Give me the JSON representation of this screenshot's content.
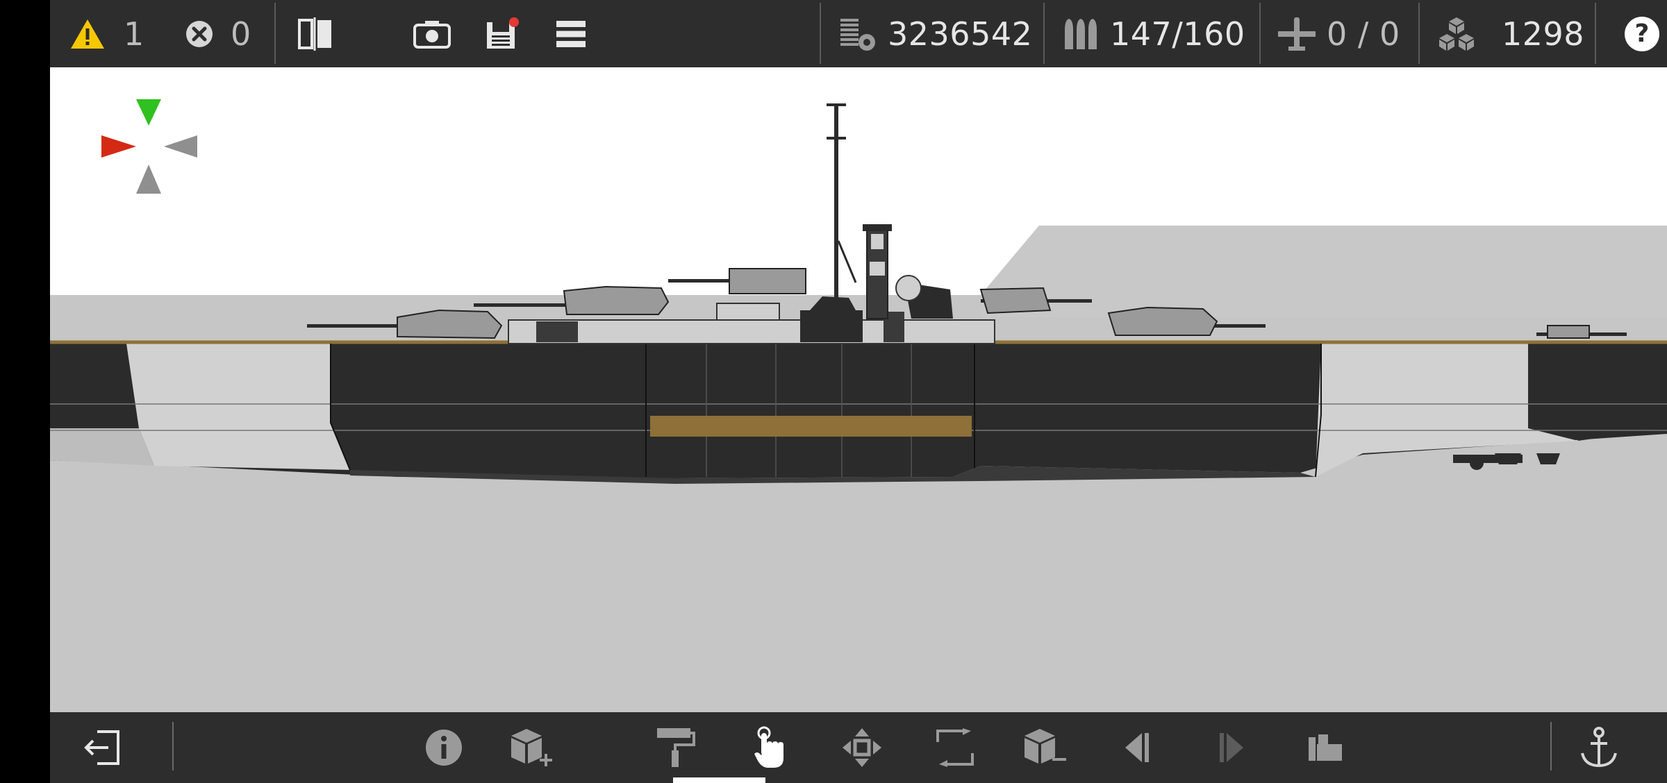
{
  "toolbar": {
    "warnings": "1",
    "errors": "0",
    "cost": "3236542",
    "ammo": "147/160",
    "aircraft": "0 / 0",
    "parts": "1298",
    "help_label": "?"
  },
  "colors": {
    "bar_bg": "#2d2d2d",
    "viewport_bg": "#c6c6c6",
    "warning": "#f7c800",
    "notification_dot": "#e53935",
    "axis_green": "#2fc11f",
    "axis_red": "#d42a14",
    "axis_gray": "#8f8f8f",
    "hull_dark": "#2b2b2b",
    "hull_light": "#cfcfcf",
    "deck_tan": "#8e7038"
  },
  "icons": {
    "warning": "warning-icon",
    "error": "error-icon",
    "mirror": "mirror-icon",
    "camera": "camera-icon",
    "save": "save-icon",
    "menu": "menu-icon",
    "cost": "cost-icon",
    "ammo": "ammo-icon",
    "aircraft": "aircraft-icon",
    "parts": "parts-icon",
    "exit": "exit-icon",
    "info": "info-icon",
    "add_block": "add-block-icon",
    "paint": "paint-roller-icon",
    "select": "select-hand-icon",
    "move": "move-icon",
    "rotate": "rotate-icon",
    "remove_block": "remove-block-icon",
    "prev": "prev-icon",
    "next": "next-icon",
    "equipment": "equipment-icon",
    "anchor": "anchor-icon"
  },
  "bottom_toolbar": {
    "active_tool": "select"
  }
}
